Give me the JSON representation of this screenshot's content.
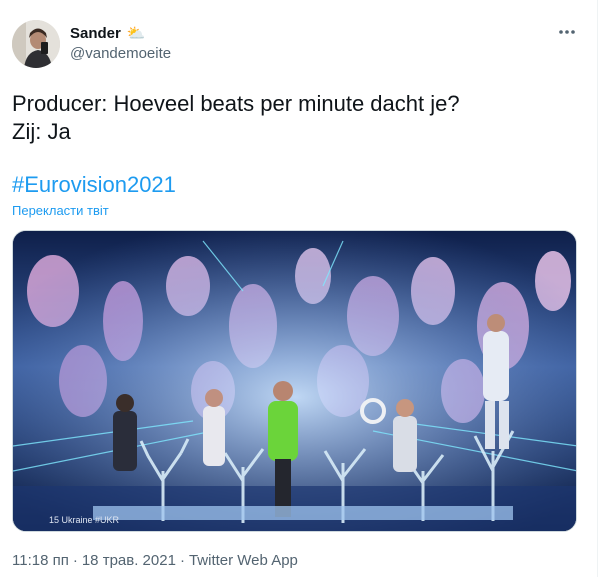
{
  "tweet": {
    "author_name": "Sander",
    "author_emoji": "⛅",
    "handle": "@vandemoeite",
    "more_icon": "ellipsis-icon",
    "text_lines": [
      "Producer: Hoeveel beats per minute dacht je?",
      "Zij: Ja"
    ],
    "hashtag": "#Eurovision2021",
    "translate_label": "Перекласти твіт",
    "media": {
      "caption": "15 Ukraine #UKR"
    },
    "time": "11:18 пп",
    "separator": "·",
    "date": "18 трав. 2021",
    "app": "Twitter Web App"
  },
  "colors": {
    "link": "#1d9bf0",
    "secondary_text": "#536471",
    "primary_text": "#0f1419"
  }
}
